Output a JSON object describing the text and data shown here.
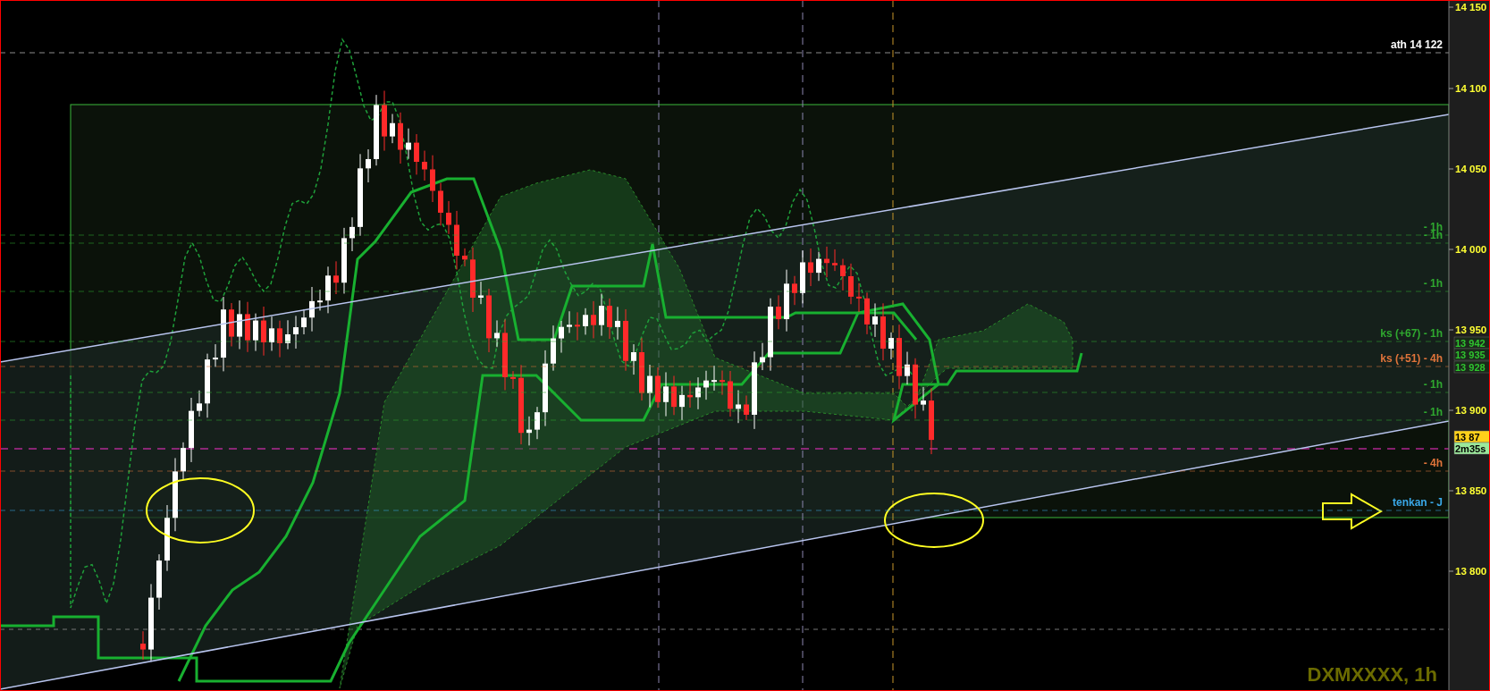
{
  "price_axis": {
    "ticks": [
      "14 150",
      "14 100",
      "14 050",
      "14 000",
      "13 950",
      "13 900",
      "13 850",
      "13 800"
    ]
  },
  "levels": [
    {
      "label": "ath 14 122",
      "color": "#ffffff"
    },
    {
      "label": "- 1h",
      "color": "#2fa82f"
    },
    {
      "label": "- 1h",
      "color": "#2fa82f"
    },
    {
      "label": "- 1h",
      "color": "#2fa82f"
    },
    {
      "label": "ks (+67) - 1h",
      "color": "#2fa82f"
    },
    {
      "label": "ks (+51) - 4h",
      "color": "#e0743a"
    },
    {
      "label": "- 1h",
      "color": "#2fa82f"
    },
    {
      "label": "- 1h",
      "color": "#2fa82f"
    },
    {
      "label": "- 4h",
      "color": "#e0743a"
    },
    {
      "label": "tenkan - J",
      "color": "#3aa8e8"
    }
  ],
  "price_tags": [
    {
      "text": "13 942",
      "kind": "level"
    },
    {
      "text": "13 935",
      "kind": "level"
    },
    {
      "text": "13 928",
      "kind": "level"
    },
    {
      "text": "13 87",
      "kind": "last"
    },
    {
      "text": "2m35s",
      "kind": "timer"
    }
  ],
  "symbol": "DXMXXXX, 1h"
}
